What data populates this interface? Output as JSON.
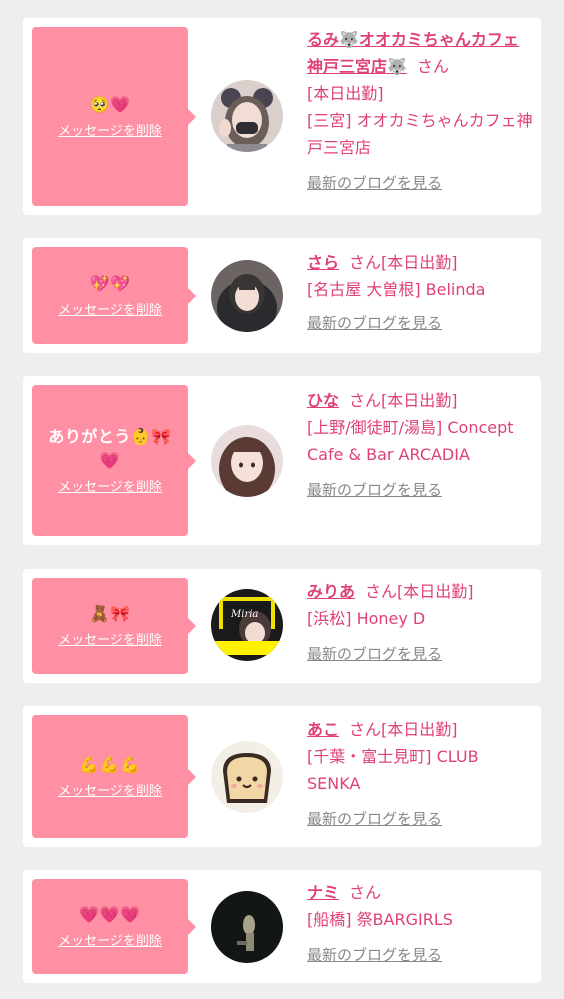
{
  "colors": {
    "page_bg": "#eeeeee",
    "bubble": "#ff8fa3",
    "accent_pink": "#e0407a",
    "link_gray": "#888888"
  },
  "common": {
    "delete_label": "メッセージを削除",
    "blog_label": "最新のブログを見る",
    "san": "さん"
  },
  "entries": [
    {
      "message": "🥺💗",
      "name": "るみ🐺オオカミちゃんカフェ神戸三宮店🐺",
      "tag": "[本日出勤]",
      "shop": "[三宮] オオカミちゃんカフェ神戸三宮店"
    },
    {
      "message": "💖💖",
      "name": "さら",
      "tag": "[本日出勤]",
      "shop": "[名古屋 大曽根] Belinda"
    },
    {
      "message": "ありがとう👶🎀💗",
      "name": "ひな",
      "tag": "[本日出勤]",
      "shop": "[上野/御徒町/湯島] Concept Cafe & Bar ARCADIA"
    },
    {
      "message": "🧸🎀",
      "name": "みりあ",
      "tag": "[本日出勤]",
      "shop": "[浜松] Honey D",
      "avatar_text": "Miria"
    },
    {
      "message": "💪💪💪",
      "name": "あこ",
      "tag": "[本日出勤]",
      "shop": "[千葉・富士見町] CLUB SENKA"
    },
    {
      "message": "💗💗💗",
      "name": "ナミ",
      "tag": "",
      "shop": "[船橋] 祭BARGIRLS"
    }
  ]
}
